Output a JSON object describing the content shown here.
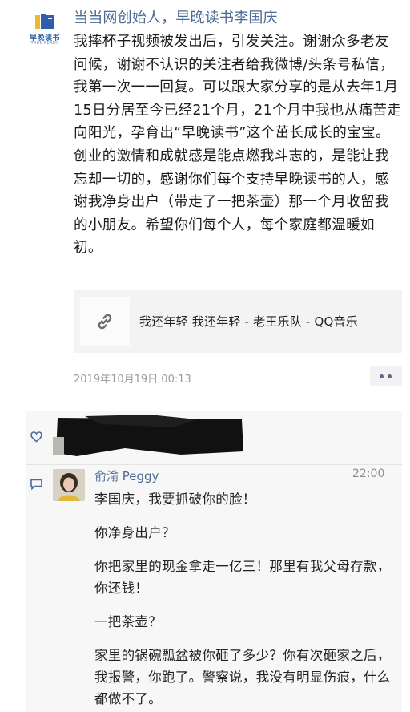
{
  "post": {
    "logo": {
      "name": "早晚读书",
      "subtitle": "TRUE READS"
    },
    "author": "当当网创始人，早晚读书李国庆",
    "content": "我摔杯子视频被发出后，引发关注。谢谢众多老友问候，谢谢不认识的关注者给我微博/头条号私信，我第一次一一回复。可以跟大家分享的是从去年1月15日分居至今已经21个月，21个月中我也从痛苦走向阳光，孕育出“早晚读书”这个茁长成长的宝宝。创业的激情和成就感是能点燃我斗志的，是能让我忘却一切的，感谢你们每个支持早晚读书的人，感谢我净身出户（带走了一把茶壶）那一个月收留我的小朋友。希望你们每个人，每个家庭都温暖如初。",
    "share": {
      "icon": "link-icon",
      "title": "我还年轻 我还年轻 - 老王乐队 - QQ音乐"
    },
    "timestamp": "2019年10月19日 00:13",
    "more_icon": "more-dots-icon"
  },
  "comments": {
    "like_icon": "heart-icon",
    "comment_icon": "comment-icon",
    "comment": {
      "name": "俞渝 Peggy",
      "time": "22:00",
      "lines": [
        "李国庆，我要抓破你的脸！",
        "你净身出户？",
        "你把家里的现金拿走一亿三！那里有我父母存款，你还钱！",
        "一把茶壶？",
        "家里的锅碗瓢盆被你砸了多少？你有次砸家之后，我报警，你跑了。警察说，我没有明显伤痕，什么都做不了。"
      ]
    }
  },
  "colors": {
    "name_blue": "#4b6a96",
    "logo_blue": "#2f5fa8",
    "logo_yellow": "#f2b632"
  }
}
